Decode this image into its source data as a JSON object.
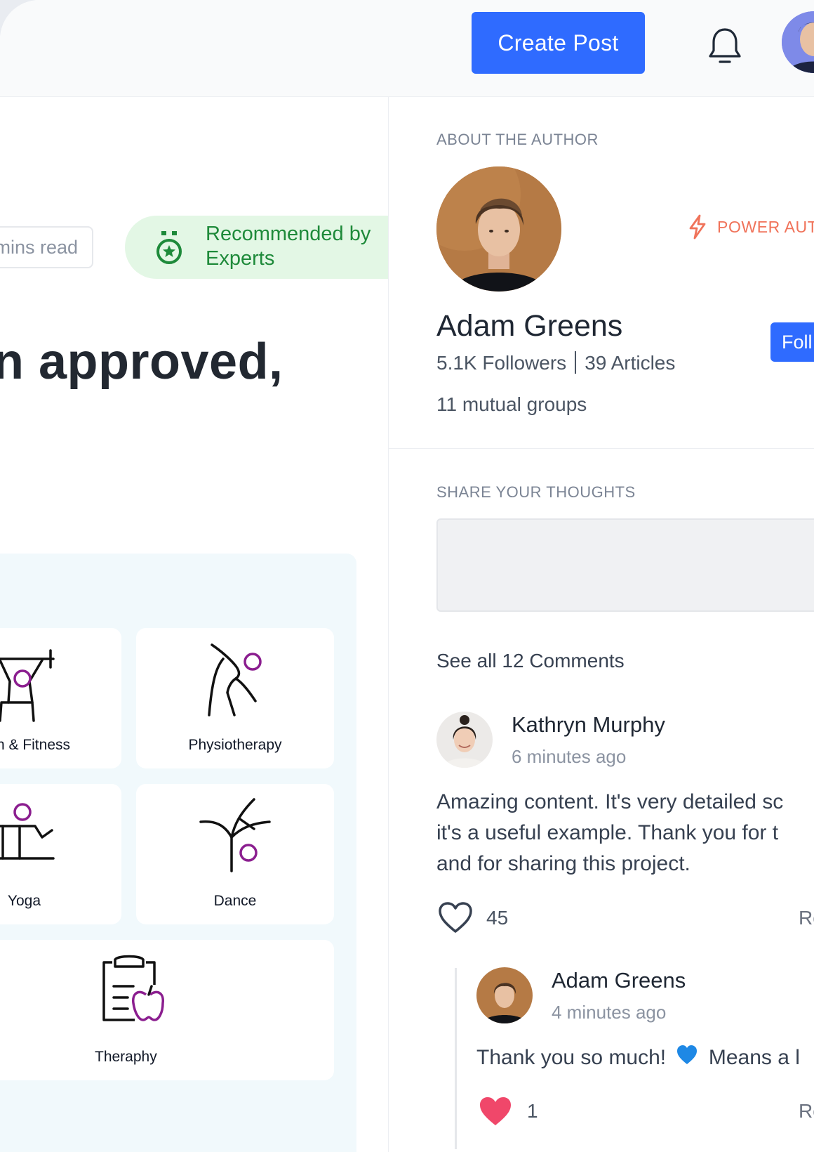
{
  "header": {
    "create_post_label": "Create Post",
    "icons": [
      "bell-icon",
      "user-avatar"
    ]
  },
  "article": {
    "read_time": "mins read",
    "recommended": "Recommended by Experts",
    "headline_fragment": "n approved,"
  },
  "categories": [
    {
      "label": "n & Fitness",
      "icon": "weightlifting-icon"
    },
    {
      "label": "Physiotherapy",
      "icon": "physiotherapy-icon"
    },
    {
      "label": "Yoga",
      "icon": "yoga-icon"
    },
    {
      "label": "Dance",
      "icon": "dance-icon"
    },
    {
      "label": "Theraphy",
      "icon": "therapy-clipboard-icon"
    }
  ],
  "author": {
    "section_label": "ABOUT THE AUTHOR",
    "badge": "POWER AUT",
    "name": "Adam Greens",
    "follow_label": "Foll",
    "followers": "5.1K Followers",
    "articles": "39 Articles",
    "mutual": "11 mutual groups"
  },
  "comments_section": {
    "share_label": "SHARE YOUR THOUGHTS",
    "see_all": "See all 12 Comments"
  },
  "comments": [
    {
      "name": "Kathryn Murphy",
      "time": "6 minutes ago",
      "lines": [
        "Amazing content. It's very detailed sc",
        "it's a useful example. Thank you for t",
        "and for sharing this project."
      ],
      "likes": "45",
      "reply": "Re",
      "liked": false
    },
    {
      "name": "Adam Greens",
      "time": "4 minutes ago",
      "text_before": "Thank you so much!",
      "text_after": "Means a l",
      "likes": "1",
      "reply": "Re",
      "liked": true
    }
  ],
  "colors": {
    "primary": "#2f6bff",
    "recommended_bg": "#e3f7e5",
    "recommended_fg": "#1e8a3a",
    "power_badge": "#f0735a",
    "heart_liked": "#f0476a",
    "category_accent": "#8b1e8f"
  }
}
